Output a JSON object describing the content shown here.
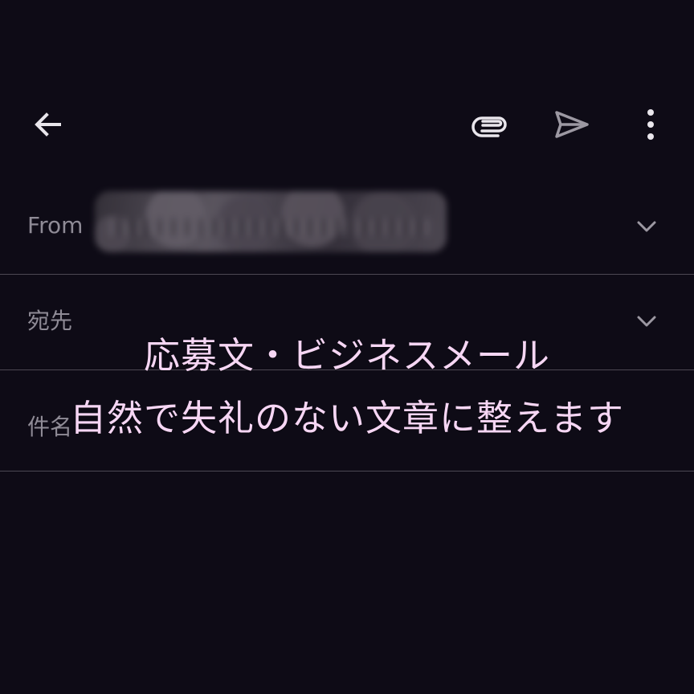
{
  "compose_screen": {
    "toolbar": {
      "back_icon": "arrow-left-icon",
      "attach_icon": "paperclip-icon",
      "send_icon": "send-icon",
      "more_icon": "more-vertical-icon"
    },
    "fields": {
      "from": {
        "label": "From",
        "value_obscured": true,
        "dropdown_icon": "chevron-down-icon"
      },
      "to": {
        "label": "宛先",
        "dropdown_icon": "chevron-down-icon"
      },
      "subject": {
        "label": "件名"
      }
    },
    "overlay_caption": {
      "line_1": "応募文・ビジネスメール",
      "line_2": "自然で失礼のない文章に整えます"
    },
    "colors": {
      "background": "#0e0b16",
      "label": "#8f8b96",
      "icon": "#e9e6ec",
      "divider": "#4c4853",
      "caption": "#f6d6f4"
    }
  }
}
